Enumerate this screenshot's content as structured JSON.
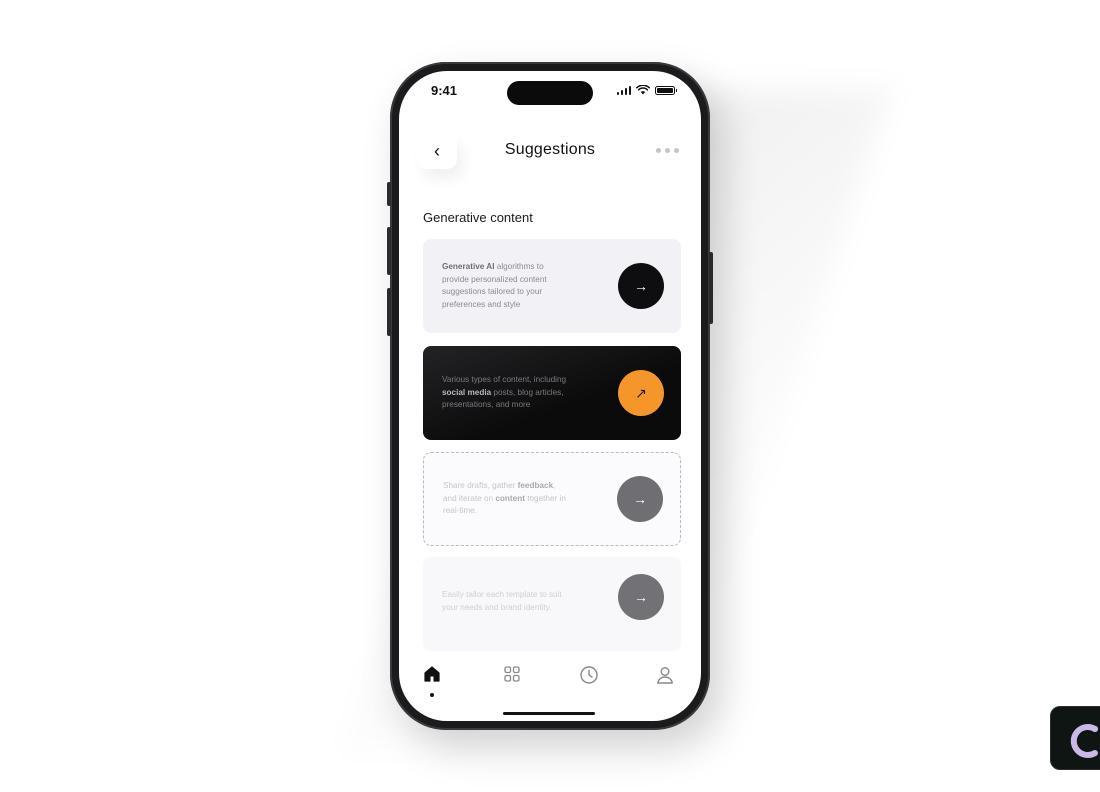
{
  "status_bar": {
    "time": "9:41",
    "icons": [
      "signal-icon",
      "wifi-icon",
      "battery-icon"
    ]
  },
  "header": {
    "back_icon": "chevron-left-icon",
    "back_glyph": "‹",
    "title": "Suggestions",
    "more_icon": "more-dots-icon"
  },
  "section": {
    "title": "Generative content"
  },
  "cards": [
    {
      "segments": [
        {
          "text": "Generative AI",
          "bold": true
        },
        {
          "text": " algorithms to provide personalized content suggestions tailored to your preferences and style",
          "bold": false
        }
      ],
      "action_icon": "arrow-right-icon",
      "action_glyph": "→"
    },
    {
      "segments": [
        {
          "text": "Various types of content, including ",
          "bold": false
        },
        {
          "text": "social media",
          "bold": true
        },
        {
          "text": " posts, blog articles, presentations, and more",
          "bold": false
        }
      ],
      "action_icon": "arrow-up-right-icon",
      "action_glyph": "↗",
      "accent": "#f5962a"
    },
    {
      "segments": [
        {
          "text": "Share drafts, gather ",
          "bold": false
        },
        {
          "text": "feedback",
          "bold": true
        },
        {
          "text": ", and iterate on ",
          "bold": false
        },
        {
          "text": "content",
          "bold": true
        },
        {
          "text": " together in real-time.",
          "bold": false
        }
      ],
      "action_icon": "arrow-right-icon",
      "action_glyph": "→"
    },
    {
      "segments": [
        {
          "text": "Easily tailor each template to suit your needs and brand identity.",
          "bold": false
        }
      ],
      "action_icon": "arrow-right-icon",
      "action_glyph": "→"
    }
  ],
  "tab_bar": {
    "tabs": [
      {
        "icon": "home-icon",
        "active": true
      },
      {
        "icon": "grid-icon",
        "active": false
      },
      {
        "icon": "clock-icon",
        "active": false
      },
      {
        "icon": "user-icon",
        "active": false
      }
    ]
  },
  "colors": {
    "accent": "#f5962a",
    "dark_card": "#0b0b0c",
    "light_card": "#f2f2f6"
  }
}
